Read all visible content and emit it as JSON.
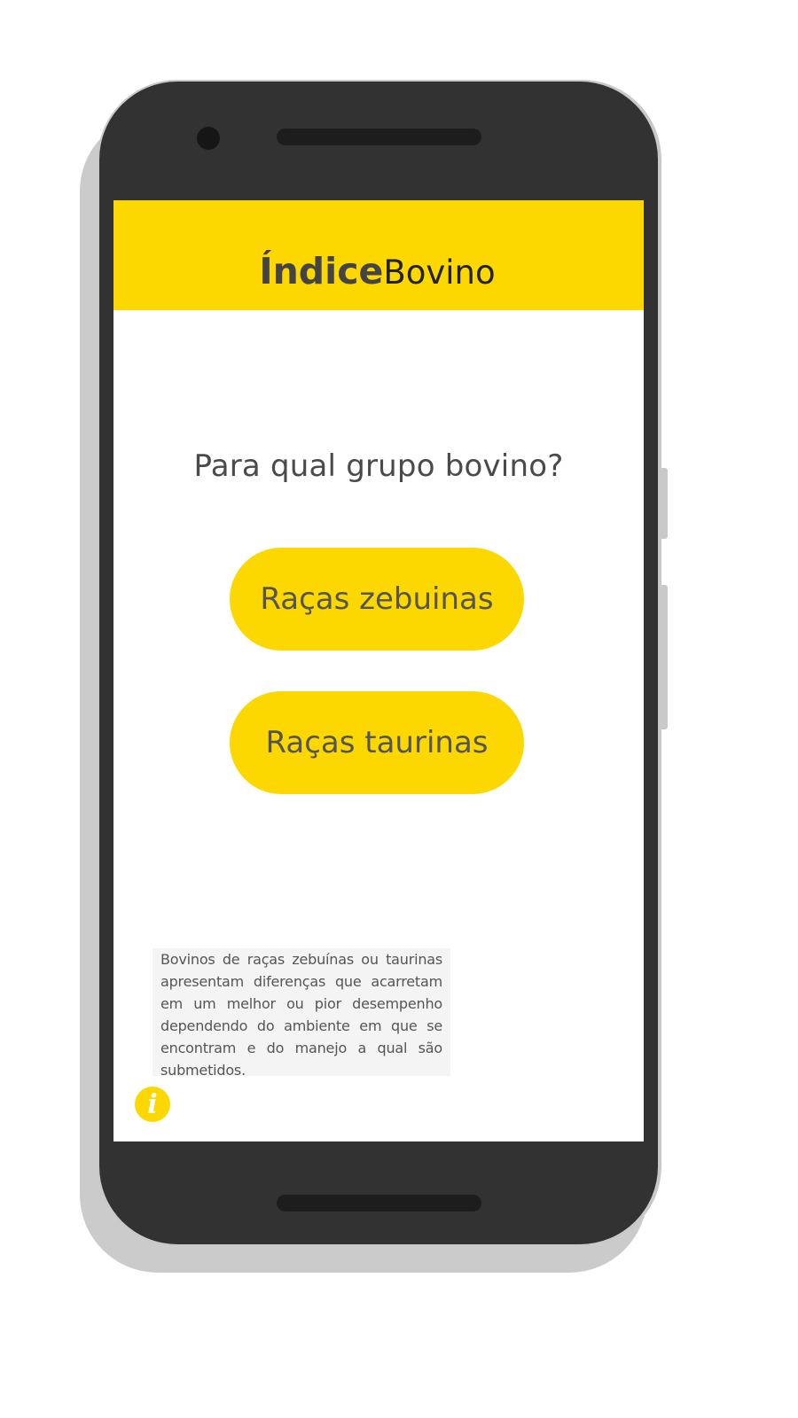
{
  "app": {
    "logo_bold": "Índice",
    "logo_light": "Bovino"
  },
  "main": {
    "question": "Para qual grupo bovino?",
    "buttons": [
      {
        "label": "Raças zebuinas"
      },
      {
        "label": "Raças taurinas"
      }
    ]
  },
  "info": {
    "text": "Bovinos de raças zebuínas ou taurinas apresentam diferenças que acarretam em um melhor ou pior desempenho dependendo do ambiente em que se encontram e do manejo a qual são submetidos.",
    "icon_glyph": "i",
    "icon": "info-icon"
  },
  "colors": {
    "accent": "#fdd700",
    "phone_body": "#323232",
    "text": "#555555"
  }
}
